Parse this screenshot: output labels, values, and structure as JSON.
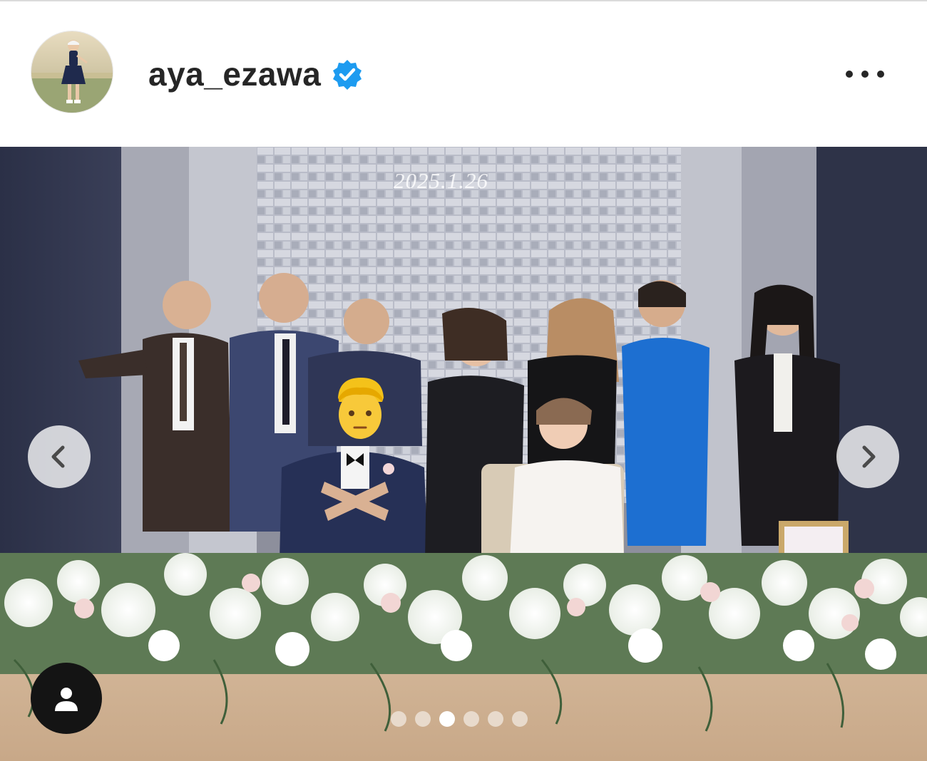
{
  "post": {
    "username": "aya_ezawa",
    "verified": true,
    "verified_badge_color": "#1d9bf0",
    "more_icon": "more-horizontal-icon"
  },
  "photo": {
    "backdrop_text": "2025.1.26",
    "carousel": {
      "total_slides": 6,
      "active_index": 2
    },
    "prev_icon": "chevron-left-icon",
    "next_icon": "chevron-right-icon",
    "tag_icon": "user-tag-icon",
    "face_cover_emoji": "👨"
  },
  "colors": {
    "text": "#262626",
    "divider": "#dbdbdb"
  }
}
